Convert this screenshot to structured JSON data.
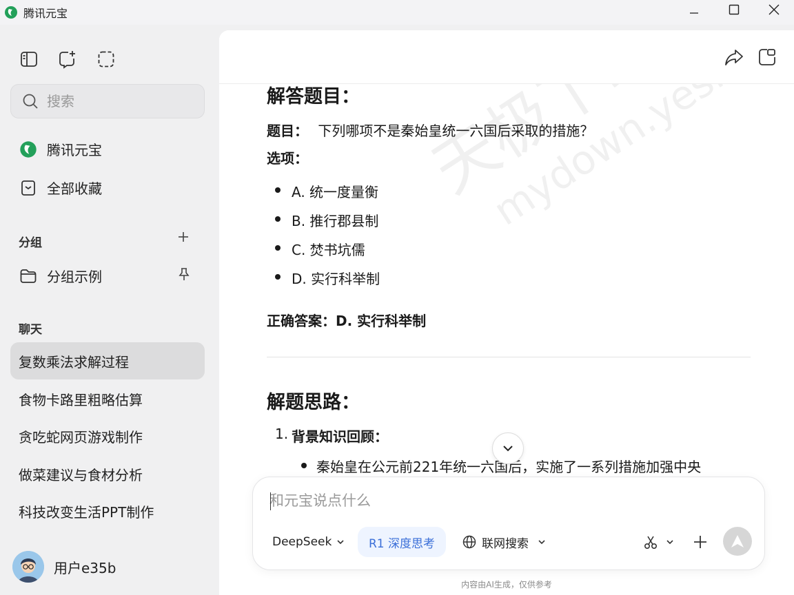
{
  "window": {
    "title": "腾讯元宝"
  },
  "sidebar": {
    "search_placeholder": "搜索",
    "nav": [
      {
        "label": "腾讯元宝"
      },
      {
        "label": "全部收藏"
      }
    ],
    "groups_header": "分组",
    "group_item": "分组示例",
    "chats_header": "聊天",
    "chats": [
      {
        "label": "复数乘法求解过程",
        "active": true
      },
      {
        "label": "食物卡路里粗略估算"
      },
      {
        "label": "贪吃蛇网页游戏制作"
      },
      {
        "label": "做菜建议与食材分析"
      },
      {
        "label": "科技改变生活PPT制作"
      }
    ],
    "user_name": "用户e35b"
  },
  "content": {
    "section1_title": "解答题目：",
    "question_label": "题目：",
    "question_text": "下列哪项不是秦始皇统一六国后采取的措施？",
    "options_label": "选项：",
    "options": [
      "A. 统一度量衡",
      "B. 推行郡县制",
      "C. 焚书坑儒",
      "D. 实行科举制"
    ],
    "answer_label": "正确答案：",
    "answer_text": "D. 实行科举制",
    "section2_title": "解题思路：",
    "step1_num": "1.",
    "step1_title": "背景知识回顾：",
    "step1_bullet": "秦始皇在公元前221年统一六国后，实施了一系列措施加强中央"
  },
  "watermark": {
    "line1": "天极下载站",
    "line2": "mydown.yesky.com"
  },
  "composer": {
    "placeholder": "和元宝说点什么",
    "model": "DeepSeek",
    "r1_label": "R1 深度思考",
    "web_search": "联网搜索"
  },
  "footer": {
    "disclaimer": "内容由AI生成，仅供参考"
  },
  "colors": {
    "accent_blue": "#3b6fd8",
    "logo_green": "#23a05a",
    "sidebar_bg": "#f0f0f1"
  }
}
